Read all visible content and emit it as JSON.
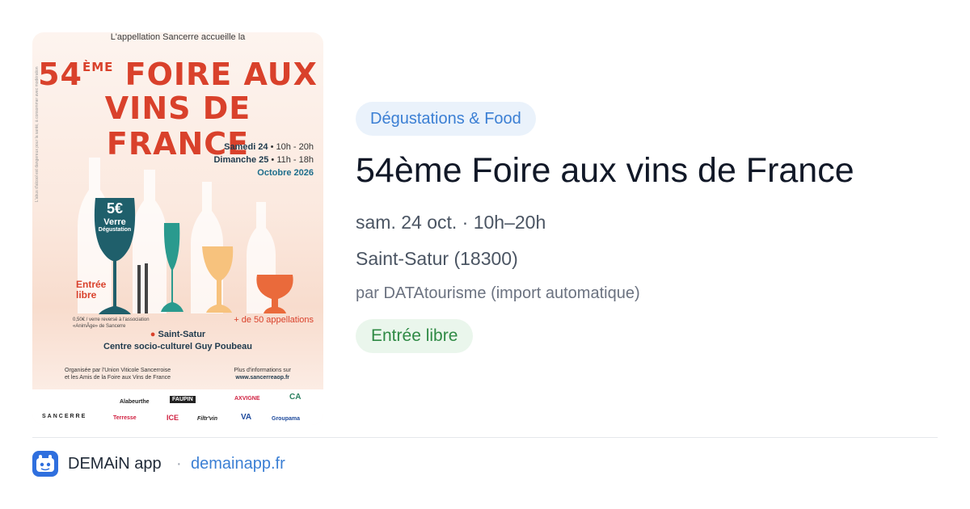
{
  "poster": {
    "intro": "L'appellation Sancerre accueille la",
    "title_number": "54",
    "title_sup": "ÈME",
    "title_line1_rest": "FOIRE AUX",
    "title_line2": "VINS DE FRANCE",
    "day1": "Samedi 24",
    "day1_hours": "• 10h - 20h",
    "day2": "Dimanche 25",
    "day2_hours": "• 11h - 18h",
    "month": "Octobre 2026",
    "glass_price": "5€",
    "glass_label": "Verre",
    "glass_sub": "Dégustation",
    "entry_line1": "Entrée",
    "entry_line2": "libre",
    "donation_line1": "0,50€ / verre reversé à l'association",
    "donation_line2": "«AnimÂge» de Sancerre",
    "appellations": "+ de 50 appellations",
    "town": "Saint-Satur",
    "venue": "Centre socio-culturel Guy Poubeau",
    "org_line1": "Organisée par l'Union Viticole Sancerroise",
    "org_line2": "et les Amis de la Foire aux Vins de France",
    "info_line1": "Plus d'informations sur",
    "info_line2": "www.sancerreaop.fr",
    "side_note": "L'abus d'alcool est dangereux pour la santé, à consommer avec modération",
    "sponsors": [
      "SANCERRE",
      "Alabeurthe",
      "FAUPIN",
      "AXVIGNE",
      "CA",
      "Terresse",
      "ICE",
      "Filtr'vin",
      "VA",
      "Groupama"
    ]
  },
  "event": {
    "category": "Dégustations & Food",
    "title": "54ème Foire aux vins de France",
    "date": "sam. 24 oct. · 10h–20h",
    "place": "Saint-Satur (18300)",
    "source": "par DATAtourisme (import automatique)",
    "price": "Entrée libre"
  },
  "footer": {
    "app_name": "DEMAiN app",
    "separator": "·",
    "domain": "demainapp.fr",
    "icon": "demain-app-icon"
  },
  "colors": {
    "accent_blue": "#3b7fd4",
    "category_bg": "#eaf2fb",
    "price_green": "#2f8a45",
    "price_bg": "#eaf6ec",
    "poster_red": "#d9412b",
    "app_icon": "#2f6fde"
  }
}
